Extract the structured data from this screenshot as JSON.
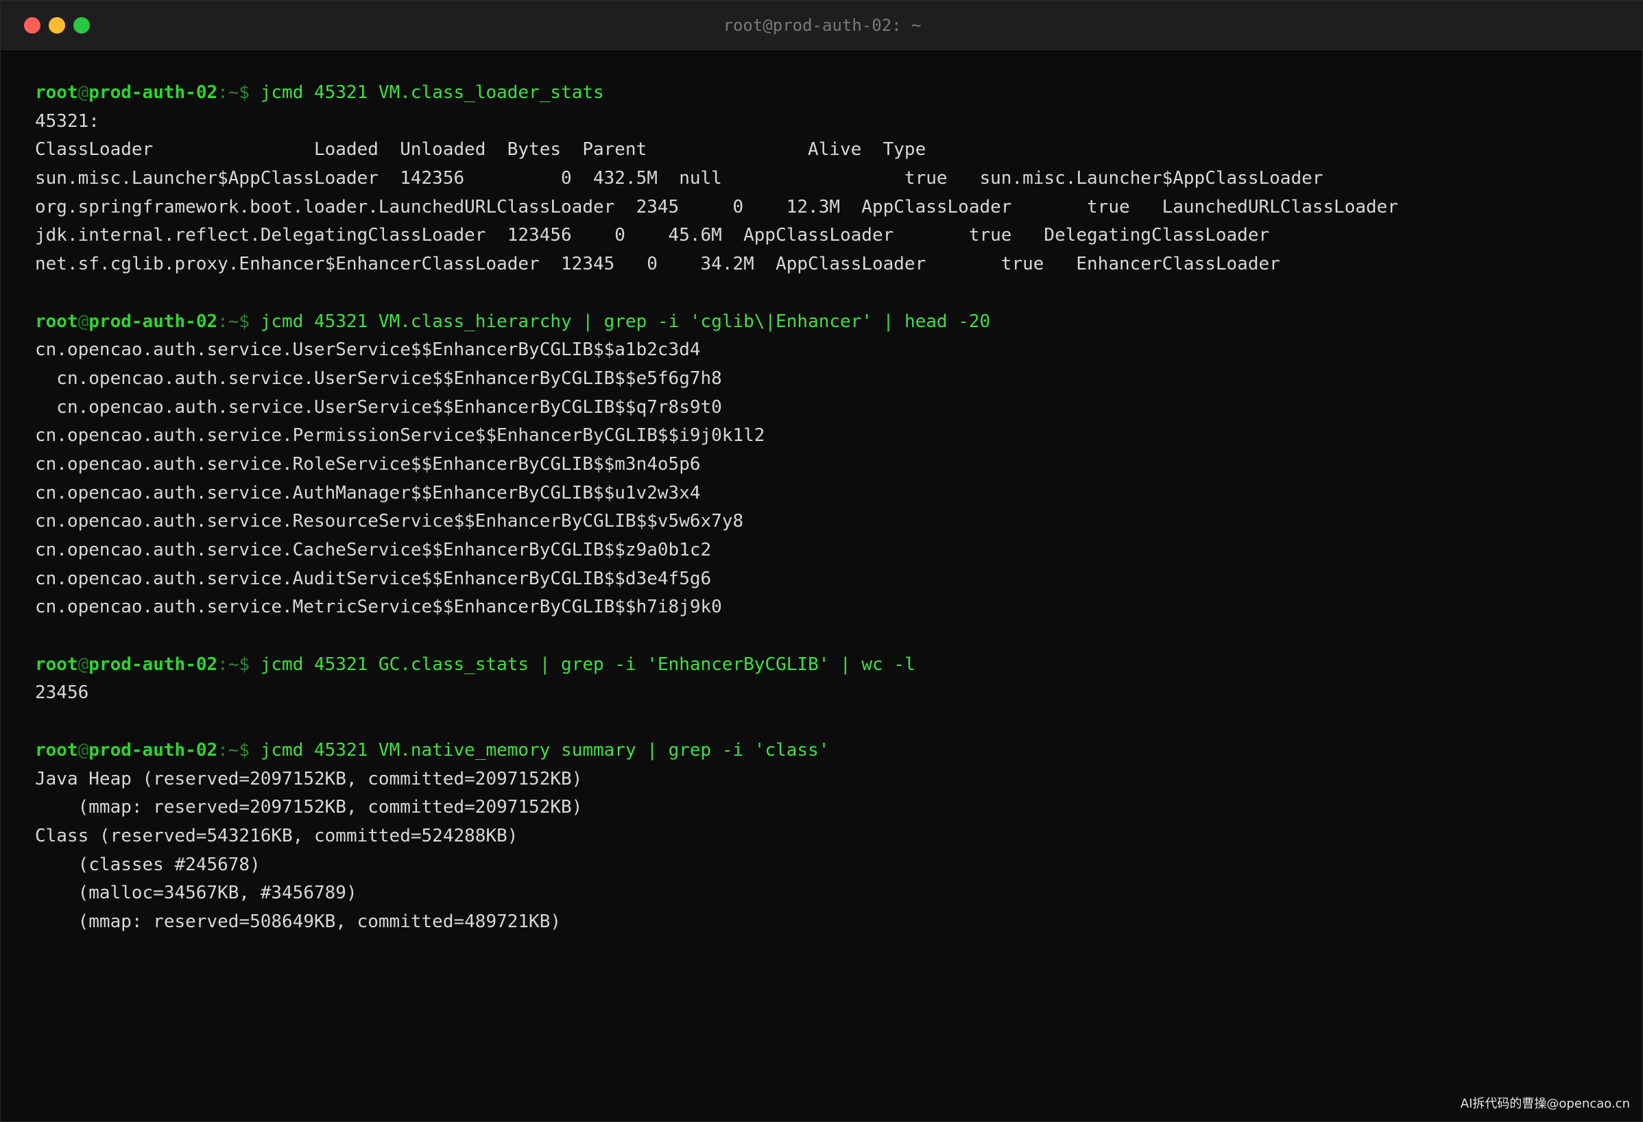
{
  "window": {
    "title": "root@prod-auth-02: ~"
  },
  "prompt": {
    "user": "root",
    "at": "@",
    "host": "prod-auth-02",
    "cwd": ":~$ "
  },
  "blocks": [
    {
      "command": "jcmd 45321 VM.class_loader_stats",
      "output": [
        "45321:",
        "ClassLoader               Loaded  Unloaded  Bytes  Parent               Alive  Type",
        "sun.misc.Launcher$AppClassLoader  142356         0  432.5M  null                 true   sun.misc.Launcher$AppClassLoader",
        "org.springframework.boot.loader.LaunchedURLClassLoader  2345     0    12.3M  AppClassLoader       true   LaunchedURLClassLoader",
        "jdk.internal.reflect.DelegatingClassLoader  123456    0    45.6M  AppClassLoader       true   DelegatingClassLoader",
        "net.sf.cglib.proxy.Enhancer$EnhancerClassLoader  12345   0    34.2M  AppClassLoader       true   EnhancerClassLoader"
      ]
    },
    {
      "command": "jcmd 45321 VM.class_hierarchy | grep -i 'cglib\\|Enhancer' | head -20",
      "output": [
        "cn.opencao.auth.service.UserService$$EnhancerByCGLIB$$a1b2c3d4",
        "  cn.opencao.auth.service.UserService$$EnhancerByCGLIB$$e5f6g7h8",
        "  cn.opencao.auth.service.UserService$$EnhancerByCGLIB$$q7r8s9t0",
        "cn.opencao.auth.service.PermissionService$$EnhancerByCGLIB$$i9j0k1l2",
        "cn.opencao.auth.service.RoleService$$EnhancerByCGLIB$$m3n4o5p6",
        "cn.opencao.auth.service.AuthManager$$EnhancerByCGLIB$$u1v2w3x4",
        "cn.opencao.auth.service.ResourceService$$EnhancerByCGLIB$$v5w6x7y8",
        "cn.opencao.auth.service.CacheService$$EnhancerByCGLIB$$z9a0b1c2",
        "cn.opencao.auth.service.AuditService$$EnhancerByCGLIB$$d3e4f5g6",
        "cn.opencao.auth.service.MetricService$$EnhancerByCGLIB$$h7i8j9k0"
      ]
    },
    {
      "command": "jcmd 45321 GC.class_stats | grep -i 'EnhancerByCGLIB' | wc -l",
      "output": [
        "23456"
      ]
    },
    {
      "command": "jcmd 45321 VM.native_memory summary | grep -i 'class'",
      "output": [
        "Java Heap (reserved=2097152KB, committed=2097152KB)",
        "    (mmap: reserved=2097152KB, committed=2097152KB)",
        "Class (reserved=543216KB, committed=524288KB)",
        "    (classes #245678)",
        "    (malloc=34567KB, #3456789)",
        "    (mmap: reserved=508649KB, committed=489721KB)"
      ]
    }
  ],
  "watermark": "AI拆代码的曹操@opencao.cn"
}
